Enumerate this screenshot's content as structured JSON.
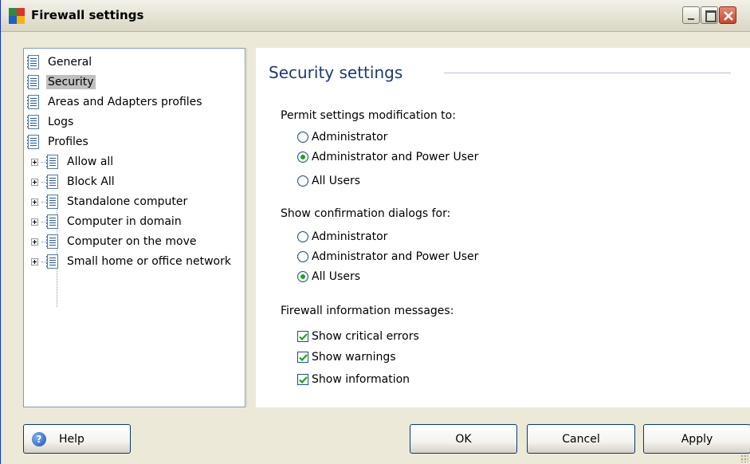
{
  "window": {
    "title": "Firewall settings",
    "icon": "avg-logo-icon",
    "controls": [
      "minimize",
      "maximize",
      "close"
    ]
  },
  "tree": {
    "items": [
      {
        "label": "General",
        "icon": "page-icon",
        "expandable": false,
        "selected": false
      },
      {
        "label": "Security",
        "icon": "page-icon",
        "expandable": false,
        "selected": true
      },
      {
        "label": "Areas and Adapters profiles",
        "icon": "page-icon",
        "expandable": false,
        "selected": false
      },
      {
        "label": "Logs",
        "icon": "page-icon",
        "expandable": false,
        "selected": false
      },
      {
        "label": "Profiles",
        "icon": "page-icon",
        "expandable": false,
        "selected": false
      },
      {
        "label": "Allow all",
        "icon": "page-icon",
        "expandable": true,
        "selected": false
      },
      {
        "label": "Block All",
        "icon": "page-icon",
        "expandable": true,
        "selected": false
      },
      {
        "label": "Standalone computer",
        "icon": "page-icon",
        "expandable": true,
        "selected": false
      },
      {
        "label": "Computer in domain",
        "icon": "page-icon",
        "expandable": true,
        "selected": false
      },
      {
        "label": "Computer on the move",
        "icon": "page-icon",
        "expandable": true,
        "selected": false
      },
      {
        "label": "Small home or office network",
        "icon": "page-icon",
        "expandable": true,
        "selected": false
      }
    ]
  },
  "content": {
    "title": "Security settings",
    "permit": {
      "label": "Permit settings modification to:",
      "options": [
        {
          "label": "Administrator",
          "checked": false
        },
        {
          "label": "Administrator and Power User",
          "checked": true
        },
        {
          "label": "All Users",
          "checked": false
        }
      ]
    },
    "confirm": {
      "label": "Show confirmation dialogs for:",
      "options": [
        {
          "label": "Administrator",
          "checked": false
        },
        {
          "label": "Administrator and Power User",
          "checked": false
        },
        {
          "label": "All Users",
          "checked": true
        }
      ]
    },
    "messages": {
      "label": "Firewall information messages:",
      "options": [
        {
          "label": "Show critical errors",
          "checked": true
        },
        {
          "label": "Show warnings",
          "checked": true
        },
        {
          "label": "Show information",
          "checked": true
        }
      ]
    }
  },
  "buttons": {
    "help": "Help",
    "ok": "OK",
    "cancel": "Cancel",
    "apply": "Apply"
  },
  "colors": {
    "window_bg": "#ECE9D8",
    "title_accent": "#1E3A70",
    "selection": "#C0C0C0",
    "radio_dot": "#21A121",
    "check_mark": "#21A121"
  }
}
